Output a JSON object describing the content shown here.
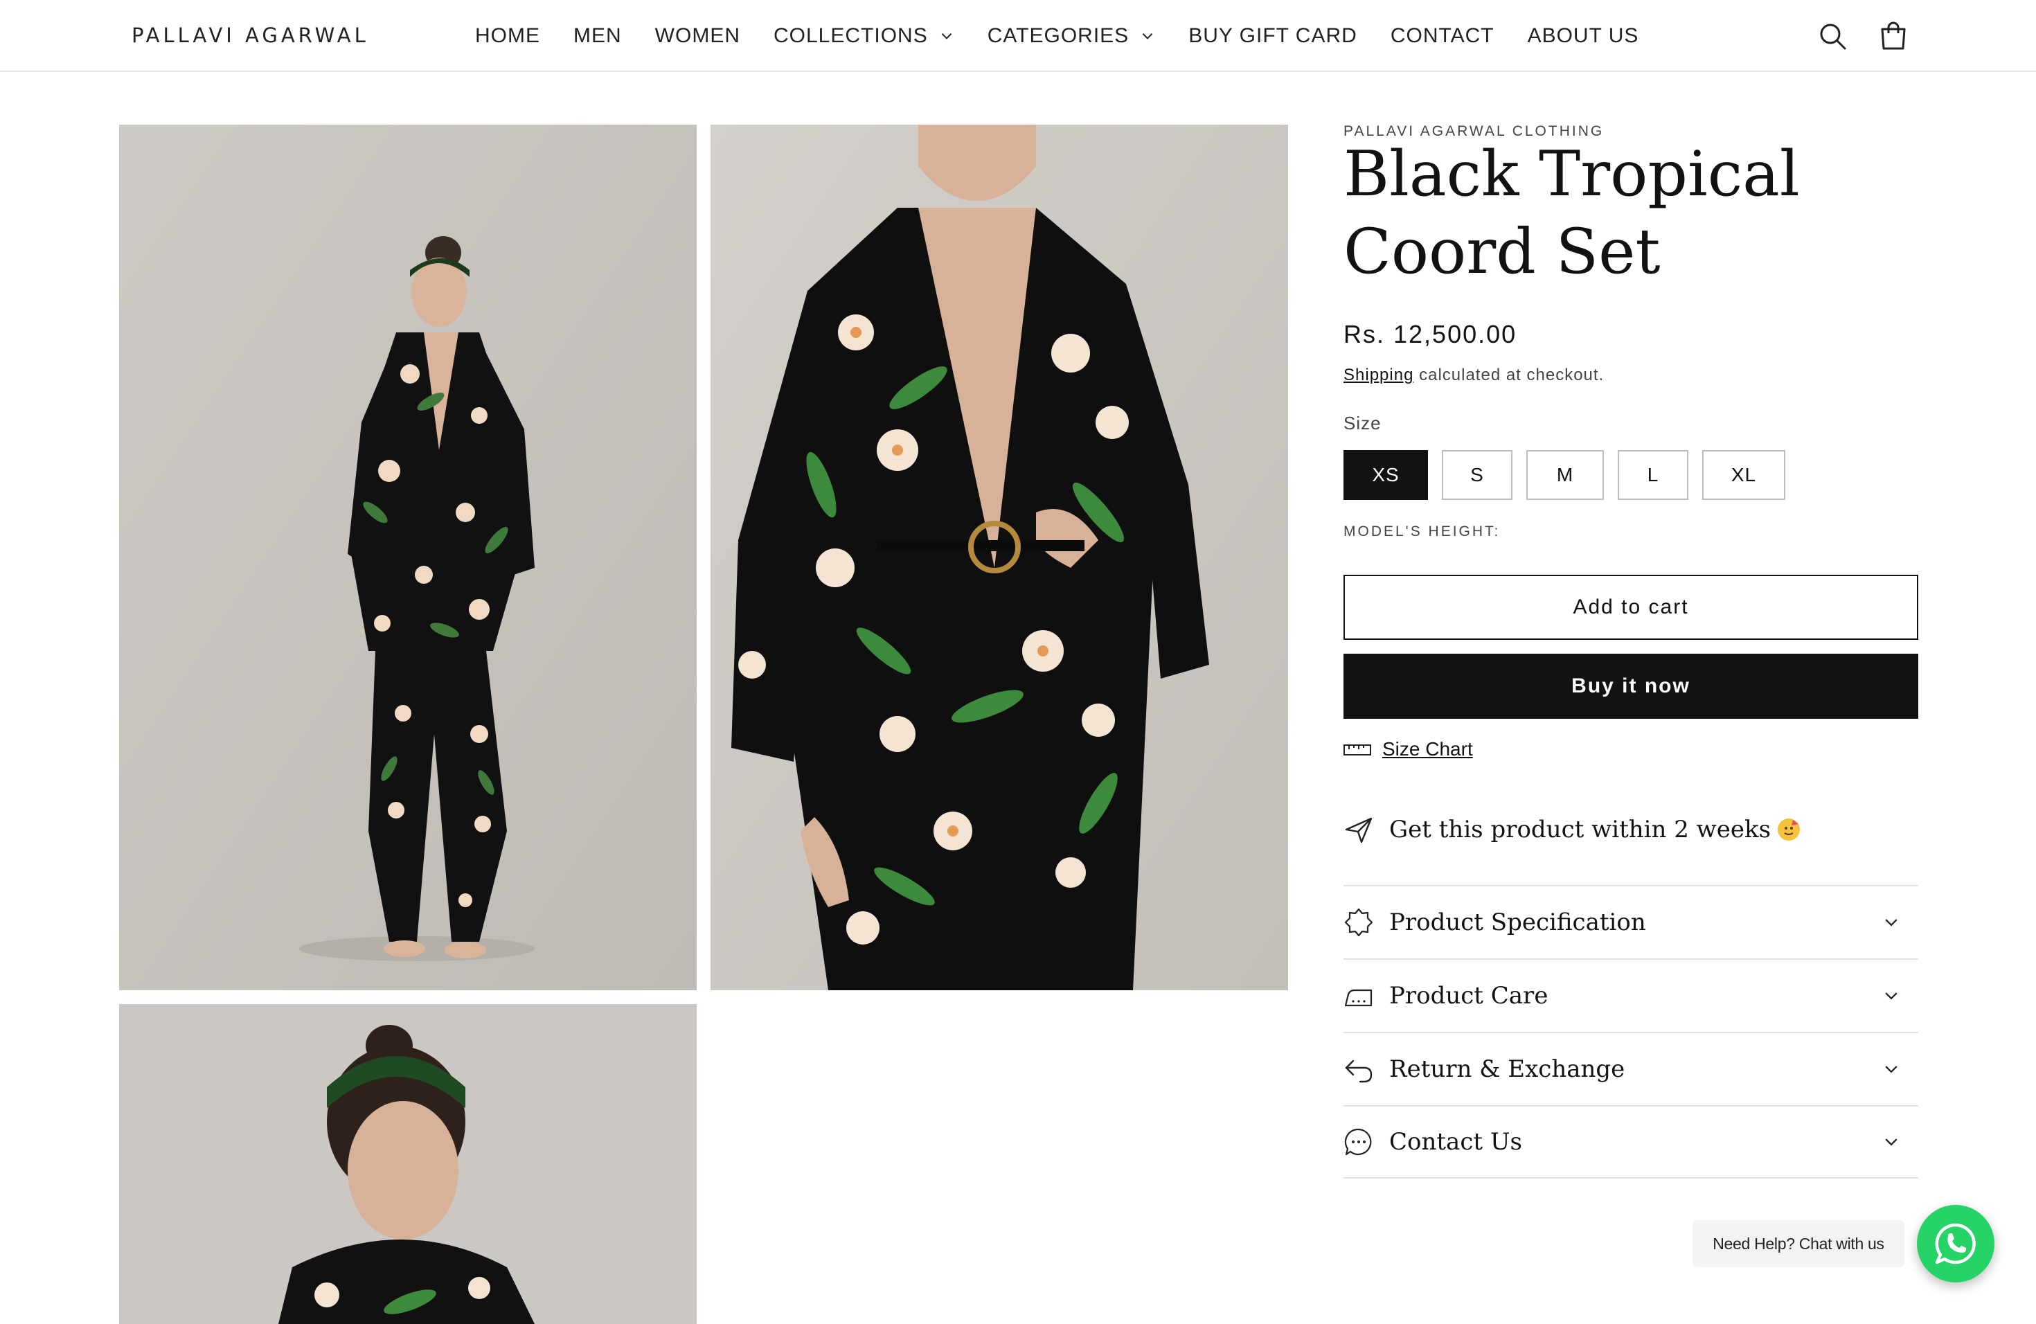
{
  "header": {
    "logo": "PALLAVI AGARWAL",
    "nav": [
      {
        "label": "HOME",
        "dropdown": false
      },
      {
        "label": "MEN",
        "dropdown": false
      },
      {
        "label": "WOMEN",
        "dropdown": false
      },
      {
        "label": "COLLECTIONS",
        "dropdown": true
      },
      {
        "label": "CATEGORIES",
        "dropdown": true
      },
      {
        "label": "BUY GIFT CARD",
        "dropdown": false
      },
      {
        "label": "CONTACT",
        "dropdown": false
      },
      {
        "label": "ABOUT US",
        "dropdown": false
      }
    ],
    "icons": [
      "search-icon",
      "cart-icon"
    ]
  },
  "product": {
    "vendor": "PALLAVI AGARWAL CLOTHING",
    "title": "Black Tropical Coord Set",
    "price": "Rs. 12,500.00",
    "shipping_link": "Shipping",
    "shipping_text": " calculated at checkout.",
    "size_label": "Size",
    "sizes": [
      "XS",
      "S",
      "M",
      "L",
      "XL"
    ],
    "selected_size": "XS",
    "model_height": "MODEL'S HEIGHT:",
    "add_to_cart": "Add to cart",
    "buy_now": "Buy it now",
    "size_chart": "Size Chart",
    "delivery": "Get this product within 2 weeks",
    "accordions": [
      {
        "title": "Product Specification",
        "icon": "badge-icon"
      },
      {
        "title": "Product Care",
        "icon": "iron-icon"
      },
      {
        "title": "Return & Exchange",
        "icon": "return-arrow-icon"
      },
      {
        "title": "Contact Us",
        "icon": "chat-icon"
      }
    ]
  },
  "chat": {
    "label": "Need Help? Chat with us",
    "icon": "whatsapp-icon"
  },
  "colors": {
    "text": "#121212",
    "background": "#ffffff",
    "whatsapp": "#25d366",
    "photo_backdrop": "#c9c5c0"
  }
}
